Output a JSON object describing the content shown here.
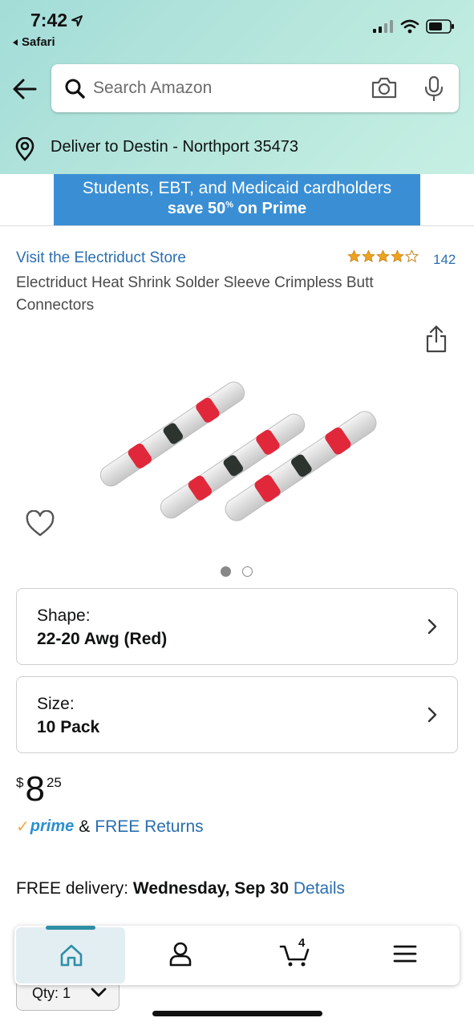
{
  "status_bar": {
    "time": "7:42",
    "back_app": "Safari"
  },
  "search": {
    "placeholder": "Search Amazon"
  },
  "delivery_location": {
    "text": "Deliver to Destin - Northport 35473"
  },
  "promo_banner": {
    "line1": "Students, EBT, and Medicaid cardholders",
    "line2_prefix": "save 50",
    "line2_sup": "%",
    "line2_suffix": " on Prime",
    "background": "#3a8fd4"
  },
  "product": {
    "store_link": "Visit the Electriduct Store",
    "rating_stars": 4,
    "rating_count": "142",
    "title": "Electriduct Heat Shrink Solder Sleeve Crimpless Butt Connectors",
    "image_count": 2,
    "active_image": 1
  },
  "options": [
    {
      "label": "Shape:",
      "value": "22-20 Awg (Red)"
    },
    {
      "label": "Size:",
      "value": "10 Pack"
    }
  ],
  "price": {
    "symbol": "$",
    "whole": "8",
    "fraction": "25"
  },
  "prime": {
    "logo_text": "prime",
    "ampersand": "&",
    "returns": "FREE Returns"
  },
  "delivery": {
    "prefix": "FREE delivery: ",
    "date": "Wednesday, Sep 30",
    "details_link": "Details"
  },
  "bottom_nav": {
    "cart_count": "4",
    "items": [
      "home-icon",
      "account-icon",
      "cart-icon",
      "menu-icon"
    ]
  },
  "quantity": {
    "label": "Qty: 1"
  },
  "colors": {
    "link": "#2a6fb0",
    "header_gradient_start": "#a3dcd8",
    "header_gradient_end": "#c6efe3",
    "star": "#f0a21e",
    "connector_red": "#e0283a"
  }
}
